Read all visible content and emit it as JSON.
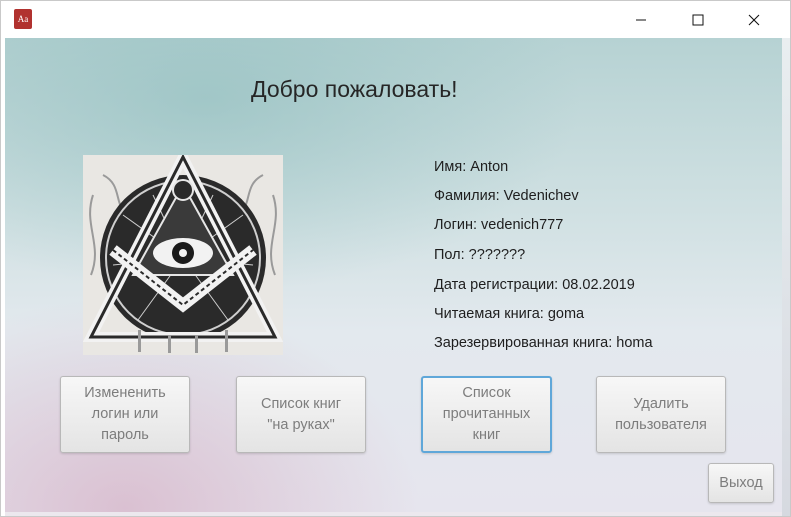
{
  "window": {
    "icon_text": "Aa",
    "controls": {
      "minimize": "minimize-icon",
      "maximize": "maximize-icon",
      "close": "close-icon"
    }
  },
  "main": {
    "title": "Добро пожаловать!",
    "avatar_icon": "eye-of-providence-triangle-icon",
    "info": {
      "name": "Имя: Anton",
      "surname": "Фамилия: Vedenichev",
      "login": "Логин: vedenich777",
      "gender": "Пол: ???????",
      "reg_date": "Дата регистрации: 08.02.2019",
      "reading_book": "Читаемая книга: goma",
      "reserved_book": "Зарезервированная книга: homa"
    },
    "buttons": {
      "change_login": "Измененить\nлогин или\nпароль",
      "books_on_hand": "Список книг\n\"на руках\"",
      "read_books": "Список\nпрочитанных\nкниг",
      "delete_user": "Удалить\nпользователя",
      "exit": "Выход"
    }
  },
  "colors": {
    "focus_border": "#5fa7d9",
    "button_text": "#7d7d7d"
  }
}
